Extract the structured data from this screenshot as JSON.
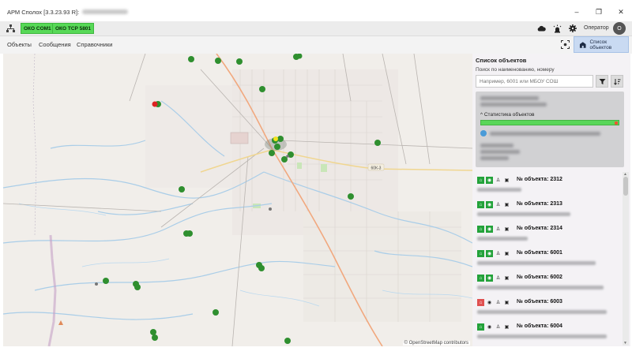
{
  "window": {
    "title": "АРМ Сполох [3.3.23.93 R]:",
    "minimize": "–",
    "maximize": "❐",
    "close": "✕"
  },
  "toolbar": {
    "badges": [
      "ОКО COM1",
      "ОКО TCP 5801"
    ],
    "operator_label": "Оператор",
    "avatar_letter": "О"
  },
  "menu": {
    "items": [
      "Объекты",
      "Сообщения",
      "Справочники"
    ],
    "list_button": "Список объектов"
  },
  "map": {
    "credit": "© OpenStreetMap contributors",
    "road_label": "60К-3"
  },
  "panel": {
    "title": "Список объектов",
    "search_label": "Поиск по наименованию, номеру",
    "search_placeholder": "Например, 6001 или МБОУ СОШ",
    "stats_title": "^ Статистика объектов",
    "objects": [
      {
        "number": "№ объекта: 2312",
        "alarm": false
      },
      {
        "number": "№ объекта: 2313",
        "alarm": false
      },
      {
        "number": "№ объекта: 2314",
        "alarm": false
      },
      {
        "number": "№ объекта: 6001",
        "alarm": false
      },
      {
        "number": "№ объекта: 6002",
        "alarm": false
      },
      {
        "number": "№ объекта: 6003",
        "alarm": true
      },
      {
        "number": "№ объекта: 6004",
        "alarm": false
      }
    ]
  },
  "colors": {
    "badge_green": "#57d957",
    "marker_green": "#2f8f2f",
    "alarm_red": "#e05050",
    "accent_blue": "#c9daf2"
  }
}
